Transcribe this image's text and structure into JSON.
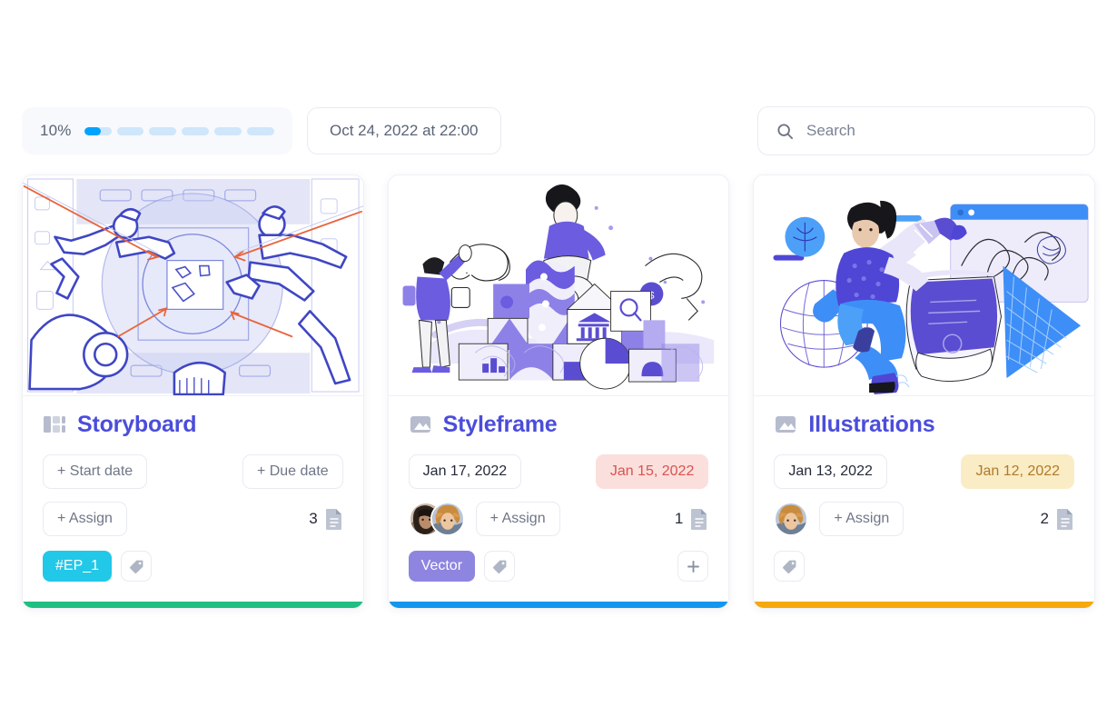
{
  "toolbar": {
    "progress": {
      "label": "10%",
      "percent": 10,
      "segments": 6,
      "fill_color": "#00a3ff",
      "track_color": "#cfe6fb"
    },
    "date": {
      "label": "Oct 24, 2022 at 22:00"
    },
    "search": {
      "icon": "search-icon",
      "placeholder": "Search",
      "value": ""
    }
  },
  "cards": [
    {
      "id": "storyboard",
      "title": "Storyboard",
      "icon": "layout-grid-icon",
      "cover_alt": "storyboard-sketch-illustration",
      "start_date": {
        "label": "+ Start date",
        "state": "empty"
      },
      "due_date": {
        "label": "+ Due date",
        "state": "empty"
      },
      "assign": {
        "label": "+ Assign"
      },
      "avatars": [],
      "attachments": {
        "count": "3",
        "icon": "document-icon"
      },
      "tags": [
        {
          "label": "#EP_1",
          "color": "#22c8e8"
        }
      ],
      "tag_button_icon": "tag-icon",
      "add_button": false,
      "accent_color": "#1fbf82"
    },
    {
      "id": "styleframe",
      "title": "Styleframe",
      "icon": "image-icon",
      "cover_alt": "building-blocks-illustration",
      "start_date": {
        "label": "Jan 17, 2022",
        "state": "set"
      },
      "due_date": {
        "label": "Jan 15, 2022",
        "state": "overdue"
      },
      "assign": {
        "label": "+ Assign"
      },
      "avatars": [
        "avatar-woman-dark-hair",
        "avatar-person-curly-hair"
      ],
      "attachments": {
        "count": "1",
        "icon": "document-icon"
      },
      "tags": [
        {
          "label": "Vector",
          "color": "#8e85e0"
        }
      ],
      "tag_button_icon": "tag-icon",
      "add_button": true,
      "add_button_icon": "plus-icon",
      "accent_color": "#1496ee"
    },
    {
      "id": "illustrations",
      "title": "Illustrations",
      "icon": "image-icon",
      "cover_alt": "designer-drawing-illustration",
      "start_date": {
        "label": "Jan 13, 2022",
        "state": "set"
      },
      "due_date": {
        "label": "Jan 12, 2022",
        "state": "warning"
      },
      "assign": {
        "label": "+ Assign"
      },
      "avatars": [
        "avatar-person-curly-hair"
      ],
      "attachments": {
        "count": "2",
        "icon": "document-icon"
      },
      "tags": [],
      "tag_button_icon": "tag-icon",
      "add_button": false,
      "accent_color": "#f5a90d"
    }
  ]
}
